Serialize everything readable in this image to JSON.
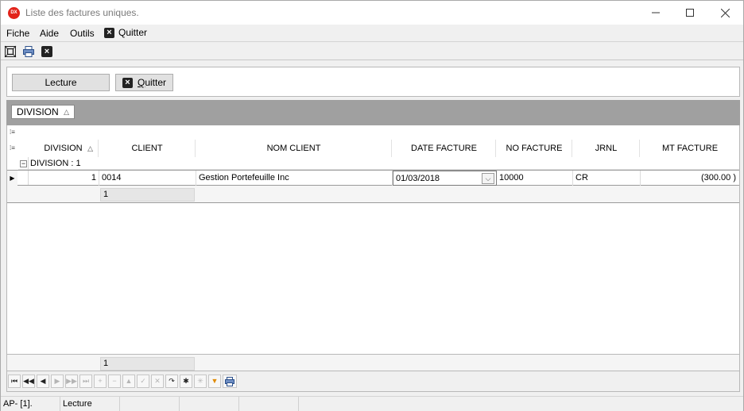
{
  "window": {
    "title": "Liste des factures uniques.",
    "app_icon_text": "DX"
  },
  "menu": {
    "fiche": "Fiche",
    "aide": "Aide",
    "outils": "Outils",
    "quitter": "Quitter"
  },
  "actions": {
    "lecture": "Lecture",
    "quitter_q": "Q",
    "quitter_rest": "uitter"
  },
  "group_panel": {
    "chip": "DIVISION"
  },
  "grid": {
    "columns": [
      "DIVISION",
      "CLIENT",
      "NOM CLIENT",
      "DATE FACTURE",
      "NO FACTURE",
      "JRNL",
      "MT FACTURE"
    ],
    "group_label": "DIVISION : 1",
    "rows": [
      {
        "division": "1",
        "client": "0014",
        "nom_client": "Gestion Portefeuille Inc",
        "date_facture": "01/03/2018",
        "no_facture": "10000",
        "jrnl": "CR",
        "mt_facture": "(300.00 )"
      }
    ],
    "group_summary": "1",
    "footer_summary": "1"
  },
  "status": {
    "cell1": "AP- [1].",
    "cell2": "Lecture"
  }
}
